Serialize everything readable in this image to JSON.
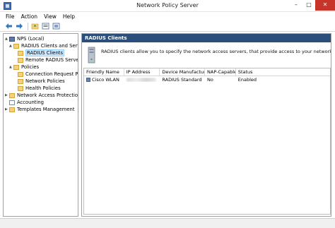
{
  "window": {
    "title": "Network Policy Server"
  },
  "window_controls": {
    "minimize": "–",
    "maximize": "□",
    "close": "✕"
  },
  "menu": [
    "File",
    "Action",
    "View",
    "Help"
  ],
  "toolbar": {
    "buttons": [
      "back-arrow-icon",
      "forward-arrow-icon",
      "folder-up-icon",
      "properties-icon",
      "help-icon"
    ]
  },
  "tree": {
    "items": [
      {
        "label": "NPS (Local)",
        "icon": "server-icon",
        "expander": "▲"
      },
      {
        "label": "RADIUS Clients and Servers",
        "icon": "folder-icon",
        "expander": "▲"
      },
      {
        "label": "RADIUS Clients",
        "icon": "folder-icon",
        "expander": ""
      },
      {
        "label": "Remote RADIUS Server",
        "icon": "folder-icon",
        "expander": ""
      },
      {
        "label": "Policies",
        "icon": "folder-icon",
        "expander": "▲"
      },
      {
        "label": "Connection Request Po",
        "icon": "folder-icon",
        "expander": ""
      },
      {
        "label": "Network Policies",
        "icon": "folder-icon",
        "expander": ""
      },
      {
        "label": "Health Policies",
        "icon": "folder-icon",
        "expander": ""
      },
      {
        "label": "Network Access Protection",
        "icon": "folder-icon",
        "expander": "▶"
      },
      {
        "label": "Accounting",
        "icon": "document-icon",
        "expander": ""
      },
      {
        "label": "Templates Management",
        "icon": "folder-icon",
        "expander": "▶"
      }
    ]
  },
  "pane": {
    "header": "RADIUS Clients",
    "description": "RADIUS clients allow you to specify the network access servers, that provide access to your network."
  },
  "list": {
    "columns": [
      "Friendly Name",
      "IP Address",
      "Device Manufacturer",
      "NAP-Capable",
      "Status"
    ],
    "rows": [
      {
        "friendly_name": "Cisco WLAN",
        "ip_address": "",
        "device_manufacturer": "RADIUS Standard",
        "nap_capable": "No",
        "status": "Enabled"
      }
    ]
  },
  "colors": {
    "header_bar": "#2b4e7a",
    "selection": "#cce8ff",
    "close_button": "#c7342a"
  }
}
